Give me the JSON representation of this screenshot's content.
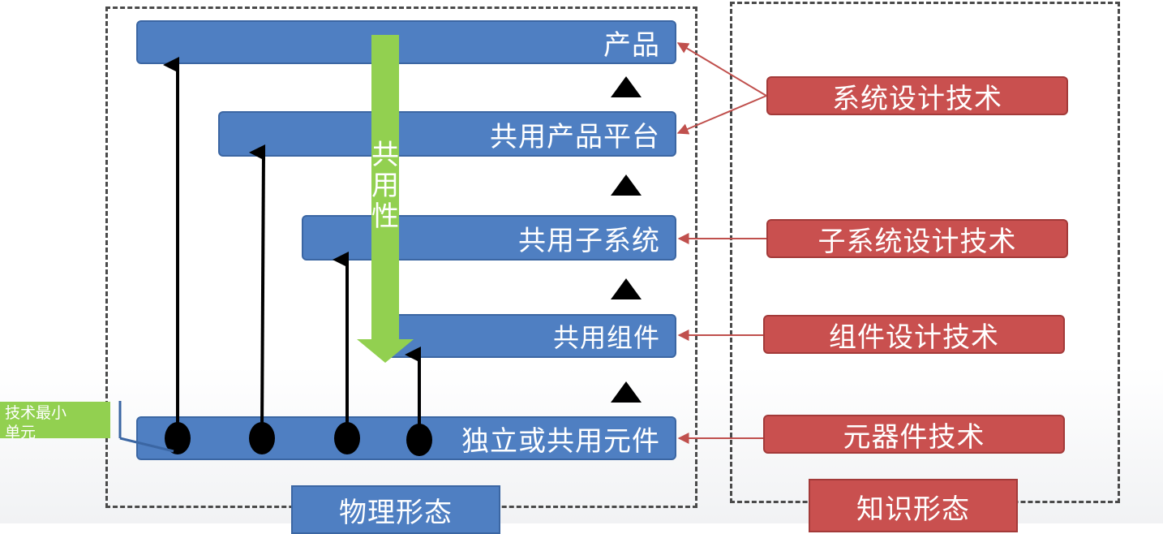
{
  "physical": {
    "product": "产品",
    "shared_platform": "共用产品平台",
    "shared_subsystem": "共用子系统",
    "shared_component": "共用组件",
    "element": "独立或共用元件",
    "caption": "物理形态"
  },
  "knowledge": {
    "system_design": "系统设计技术",
    "subsystem_design": "子系统设计技术",
    "component_design": "组件设计技术",
    "element_tech": "元器件技术",
    "caption": "知识形态"
  },
  "commonality": {
    "char1": "共",
    "char2": "用",
    "char3": "性"
  },
  "note": {
    "line1": "技术最小",
    "line2": "单元"
  },
  "colors": {
    "bar_blue": "#4f7fc2",
    "tech_red": "#c9504f",
    "green_arrow": "#92d050",
    "connector_red": "#c0504d"
  }
}
